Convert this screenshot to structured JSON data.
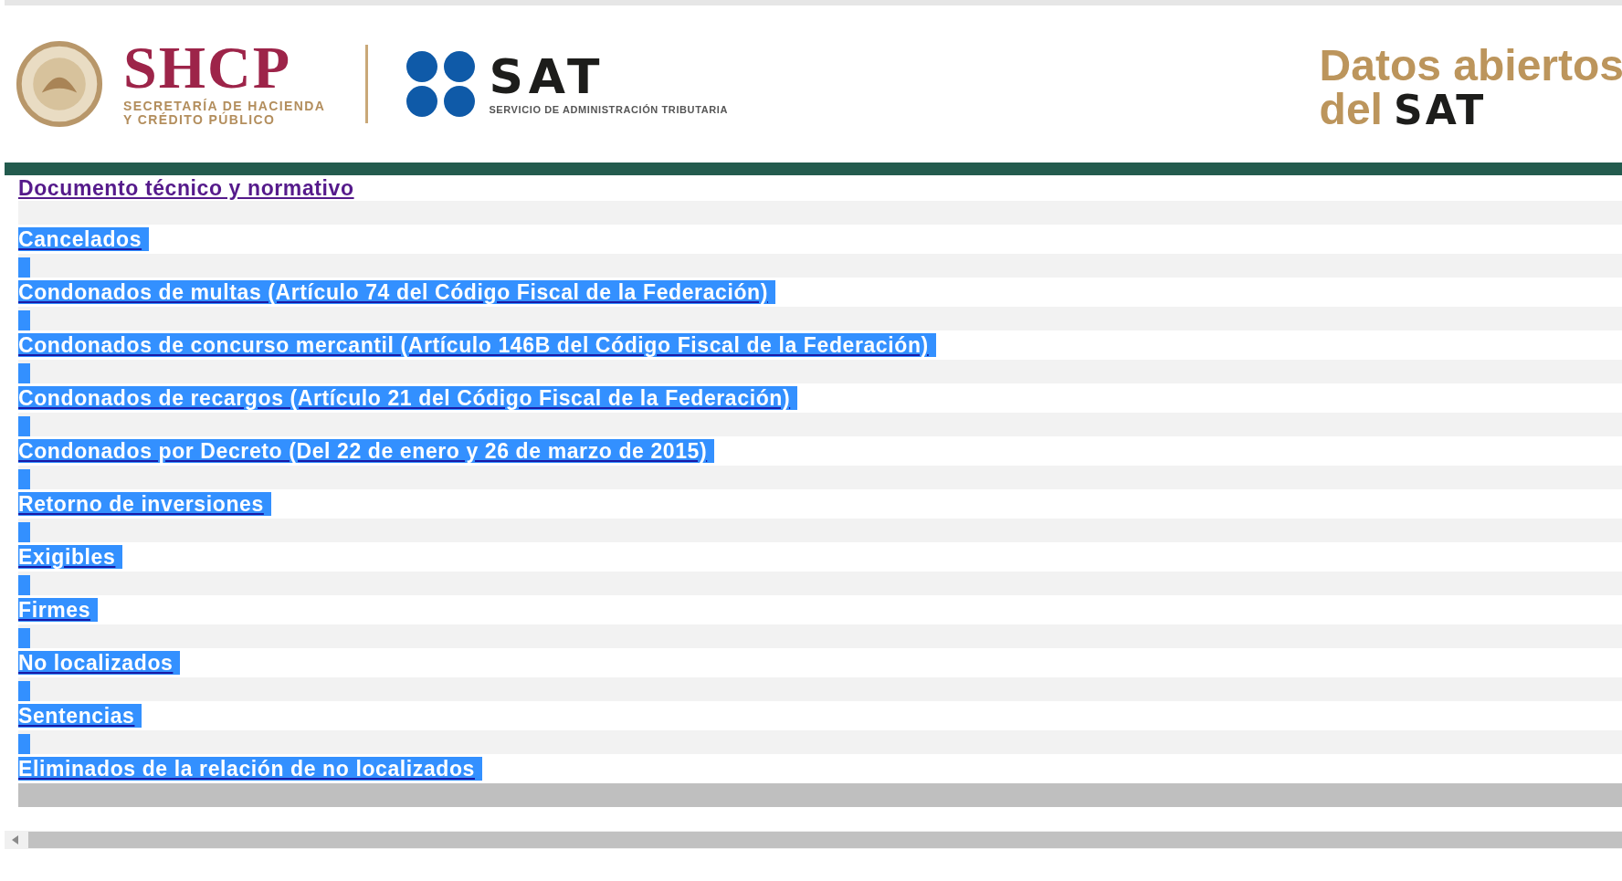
{
  "header": {
    "shcp": {
      "title": "SHCP",
      "subtitle_lines": [
        "SECRETARÍA DE HACIENDA",
        "Y CRÉDITO PÚBLICO"
      ]
    },
    "sat": {
      "title": "SAT",
      "subtitle": "SERVICIO DE ADMINISTRACIÓN TRIBUTARIA"
    },
    "portal": {
      "line_1": "Datos abiertos",
      "line_2": "del",
      "line_2_brand": "SAT"
    }
  },
  "links": [
    {
      "text": "Documento técnico y normativo",
      "highlighted": false
    },
    {
      "text": "Cancelados",
      "highlighted": true
    },
    {
      "text": "Condonados de multas (Artículo 74 del Código Fiscal de la Federación)",
      "highlighted": true
    },
    {
      "text": "Condonados de concurso mercantil (Artículo 146B del Código Fiscal de la Federación)",
      "highlighted": true
    },
    {
      "text": "Condonados de recargos (Artículo 21 del Código Fiscal de la Federación)",
      "highlighted": true
    },
    {
      "text": "Condonados por Decreto (Del 22 de enero y 26 de marzo de 2015)",
      "highlighted": true
    },
    {
      "text": "Retorno de inversiones",
      "highlighted": true
    },
    {
      "text": "Exigibles",
      "highlighted": true
    },
    {
      "text": "Firmes",
      "highlighted": true
    },
    {
      "text": "No localizados",
      "highlighted": true
    },
    {
      "text": "Sentencias",
      "highlighted": true
    },
    {
      "text": "Eliminados de la relación de no localizados",
      "highlighted": true
    }
  ]
}
